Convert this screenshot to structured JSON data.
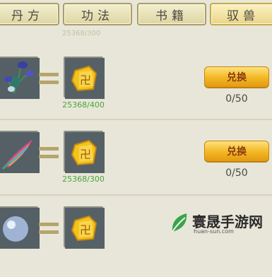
{
  "tabs": [
    {
      "label": "丹方",
      "active": false
    },
    {
      "label": "功法",
      "active": false
    },
    {
      "label": "书籍",
      "active": false
    },
    {
      "label": "驭兽",
      "active": true
    }
  ],
  "top_faded_text": "25368/300",
  "rows": [
    {
      "item_icon": "blue-flower-icon",
      "currency_icon": "gold-swastika-coin-icon",
      "cost": "25368/400",
      "button_label": "兑换",
      "count": "0/50"
    },
    {
      "item_icon": "rainbow-feather-icon",
      "currency_icon": "gold-swastika-coin-icon",
      "cost": "25368/300",
      "button_label": "兑换",
      "count": "0/50"
    },
    {
      "item_icon": "crystal-orb-icon",
      "currency_icon": "gold-swastika-coin-icon",
      "cost": "",
      "button_label": "",
      "count": ""
    }
  ],
  "watermark": {
    "title": "寰晟手游网",
    "url": "huan-sun.com"
  },
  "colors": {
    "background": "#e8e6d8",
    "cost_green": "#49a43b",
    "button_gold": "#f2b623",
    "item_box": "#576063"
  }
}
